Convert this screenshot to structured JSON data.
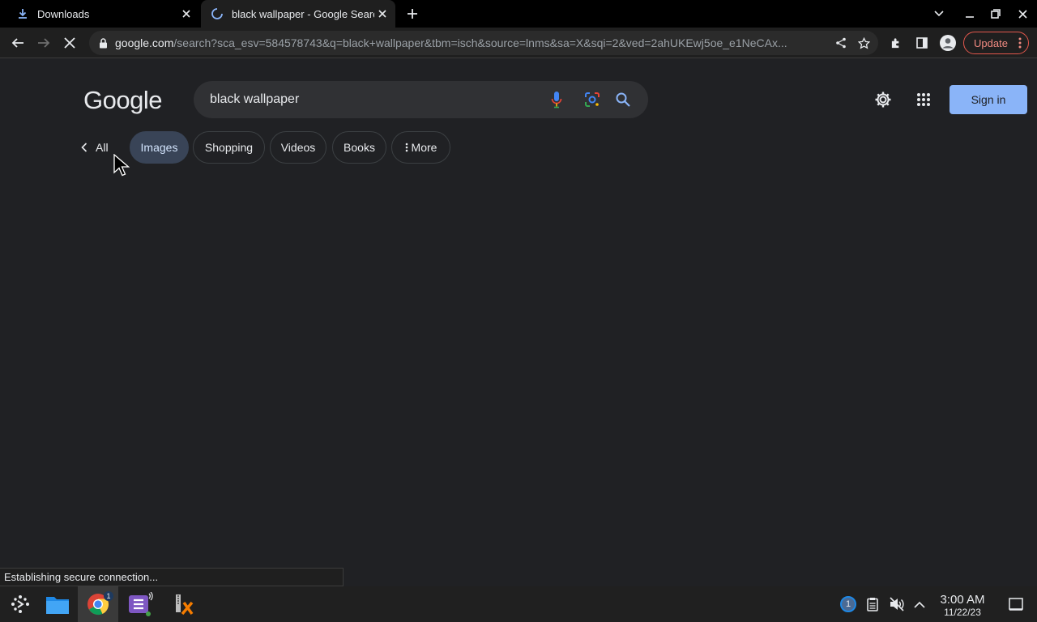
{
  "browser": {
    "tabs": [
      {
        "title": "Downloads",
        "icon": "download-icon",
        "active": false
      },
      {
        "title": "black wallpaper - Google Search",
        "icon": "loading-spinner-icon",
        "active": true
      }
    ],
    "url_host": "google.com",
    "url_path": "/search?sca_esv=584578743&q=black+wallpaper&tbm=isch&source=lnms&sa=X&sqi=2&ved=2ahUKEwj5oe_e1NeCAx...",
    "update_label": "Update"
  },
  "page": {
    "logo": "Google",
    "search_query": "black wallpaper",
    "sign_in_label": "Sign in",
    "filters": {
      "all": "All",
      "images": "Images",
      "shopping": "Shopping",
      "videos": "Videos",
      "books": "Books",
      "more": "More"
    },
    "selected_filter": "Images"
  },
  "status_text": "Establishing secure connection...",
  "taskbar": {
    "chrome_badge": "1",
    "tray_badge": "1",
    "time": "3:00 AM",
    "date": "11/22/23"
  },
  "colors": {
    "page_bg": "#202124",
    "accent_blue": "#8ab4f8",
    "selected_chip": "#394457",
    "update_red": "#f28b82"
  }
}
